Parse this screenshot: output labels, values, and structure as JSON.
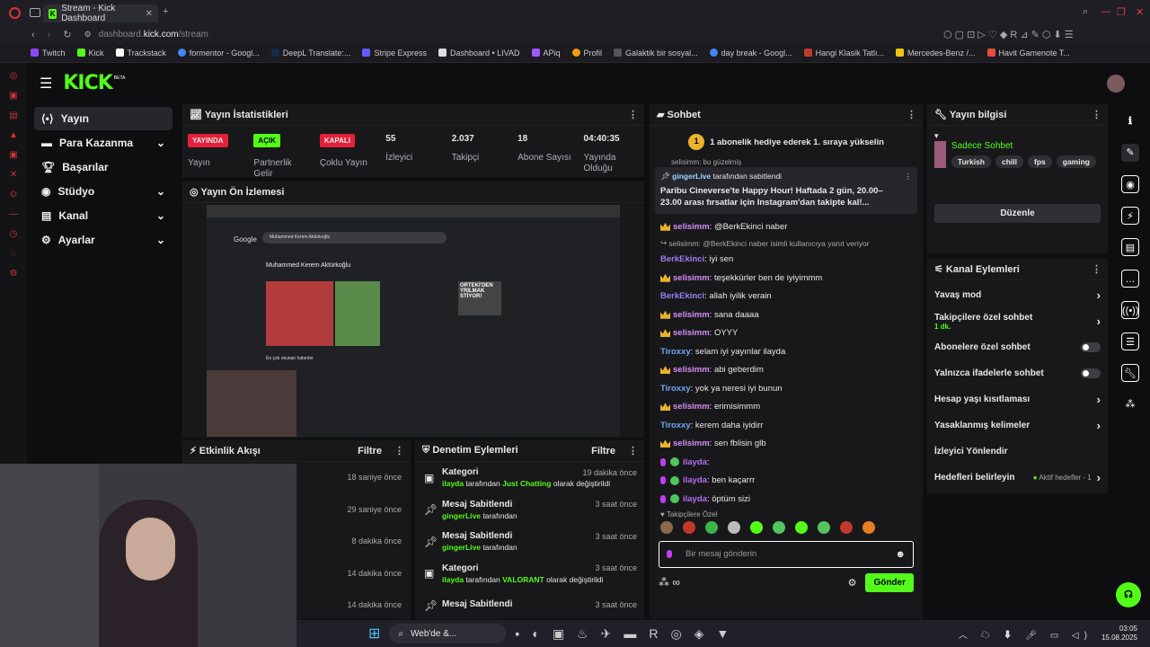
{
  "browser": {
    "tab_title": "Stream - Kick Dashboard",
    "url_domain": "dashboard.",
    "url_host": "kick.com",
    "url_path": "/stream",
    "bookmarks": [
      "Twitch",
      "Kick",
      "Trackstack",
      "formentor - Googl...",
      "DeepL Translate:...",
      "Stripe Express",
      "Dashboard • LIVAD",
      "APiq",
      "Profil",
      "Galaktik bir sosyal...",
      "day break - Googl...",
      "Hangi Klasik Tatlı...",
      "Mercedes-Benz /...",
      "Havit Gamenote T..."
    ]
  },
  "header": {
    "logo": "KICK",
    "beta": "BETA"
  },
  "sidebar": {
    "items": [
      {
        "label": "Yayın",
        "active": true,
        "expand": false
      },
      {
        "label": "Para Kazanma",
        "expand": true
      },
      {
        "label": "Başarılar",
        "expand": false
      },
      {
        "label": "Stüdyo",
        "expand": true
      },
      {
        "label": "Kanal",
        "expand": true
      },
      {
        "label": "Ayarlar",
        "expand": true
      }
    ]
  },
  "stats": {
    "title": "Yayın İstatistikleri",
    "cells": [
      {
        "pill": "YAYINDA",
        "pill_color": "#e5203a",
        "label": "Yayın"
      },
      {
        "pill": "AÇIK",
        "pill_color": "#53fc18",
        "label": "Partnerlik Gelir"
      },
      {
        "pill": "KAPALI",
        "pill_color": "#e5203a",
        "label": "Çoklu Yayın"
      },
      {
        "value": "55",
        "label": "İzleyici"
      },
      {
        "value": "2.037",
        "label": "Takipçi"
      },
      {
        "value": "18",
        "label": "Abone Sayısı"
      },
      {
        "value": "04:40:35",
        "label": "Yayında Olduğu"
      }
    ]
  },
  "preview": {
    "title": "Yayın Ön İzlemesi",
    "search_name": "Muhammed Kerem Aktürkoğlu",
    "headline": "Muhammed Kerem Aktürkoğlu",
    "news": "En çok okunan haberler",
    "overlay": "ORTEKİ'DEN YRILMAK STİYOR!"
  },
  "activity": {
    "title": "Etkinlik Akışı",
    "filter": "Filtre",
    "times": [
      "18 saniye önce",
      "29 saniye önce",
      "8 dakika önce",
      "14 dakika önce",
      "14 dakika önce"
    ]
  },
  "moderation": {
    "title": "Denetim Eylemleri",
    "filter": "Filtre",
    "items": [
      {
        "title": "Kategori",
        "time": "19 dakika önce",
        "user": "ilayda",
        "mid": "tarafından",
        "tag": "Just Chatting",
        "tail": "olarak değiştirildi"
      },
      {
        "title": "Mesaj Sabitlendi",
        "time": "3 saat önce",
        "user": "gingerLive",
        "mid": "tarafından",
        "tag": "",
        "tail": ""
      },
      {
        "title": "Mesaj Sabitlendi",
        "time": "3 saat önce",
        "user": "gingerLive",
        "mid": "tarafından",
        "tag": "",
        "tail": ""
      },
      {
        "title": "Kategori",
        "time": "3 saat önce",
        "user": "ilayda",
        "mid": "tarafından",
        "tag": "VALORANT",
        "tail": "olarak değiştirildi"
      },
      {
        "title": "Mesaj Sabitlendi",
        "time": "3 saat önce",
        "user": "",
        "mid": "",
        "tag": "",
        "tail": ""
      }
    ]
  },
  "chat": {
    "title": "Sohbet",
    "gift_count": "1",
    "gift_text": "1 abonelik hediye ederek 1. sıraya yükselin",
    "partial_top": "selisimm: bu güzelmiş",
    "pinned_by": "gingerLive",
    "pinned_suffix": "tarafından sabitlendi",
    "pinned_text": "Paribu Cineverse'te Happy Hour! Haftada 2 gün, 20.00–23.00 arası fırsatlar için Instagram'dan takipte kal!...",
    "reply_note": "selisimm: @BerkEkinci naber isimli kullanıcıya yanıt veriyor",
    "messages": [
      {
        "user": "selisimm",
        "text": "@BerkEkinci naber",
        "style": "y",
        "badge": "crown"
      },
      {
        "user": "BerkEkinci",
        "text": "iyi sen",
        "style": "b",
        "badge": ""
      },
      {
        "user": "selisimm",
        "text": "teşekkürler ben de iyiyimmm",
        "style": "y",
        "badge": "crown"
      },
      {
        "user": "BerkEkinci",
        "text": "allah iyilik verain",
        "style": "b",
        "badge": ""
      },
      {
        "user": "selisimm",
        "text": "sana daaaa",
        "style": "y",
        "badge": "crown"
      },
      {
        "user": "selisimm",
        "text": "OYYY",
        "style": "y",
        "badge": "crown"
      },
      {
        "user": "Tiroxxy",
        "text": "selam iyi yayınlar ilayda",
        "style": "t",
        "badge": ""
      },
      {
        "user": "selisimm",
        "text": "abi geberdim",
        "style": "y",
        "badge": "crown"
      },
      {
        "user": "Tiroxxy",
        "text": "yok ya neresi iyi bunun",
        "style": "t",
        "badge": ""
      },
      {
        "user": "selisimm",
        "text": "erimisimmm",
        "style": "y",
        "badge": "crown"
      },
      {
        "user": "Tiroxxy",
        "text": "kerem daha iyidirr",
        "style": "t",
        "badge": ""
      },
      {
        "user": "selisimm",
        "text": "sen fblisin glb",
        "style": "y",
        "badge": "crown"
      },
      {
        "user": "ilayda",
        "text": "",
        "style": "p",
        "badge": "mod"
      },
      {
        "user": "ilayda",
        "text": "ben kaçarrr",
        "style": "p",
        "badge": "mod"
      },
      {
        "user": "ilayda",
        "text": "öptüm sizi",
        "style": "p",
        "badge": "mod"
      }
    ],
    "emote_label": "Takipçilere Özel",
    "input_placeholder": "Bir mesaj gönderin",
    "send_label": "Gönder"
  },
  "stream_info": {
    "title": "Yayın bilgisi",
    "subtitle": "Sadece Sohbet",
    "tags": [
      "Turkish",
      "chill",
      "fps",
      "gaming"
    ],
    "edit_label": "Düzenle"
  },
  "channel_actions": {
    "title": "Kanal Eylemleri",
    "items": [
      {
        "label": "Yavaş mod",
        "type": "chevron",
        "sub": ""
      },
      {
        "label": "Takipçilere özel sohbet",
        "type": "chevron",
        "sub": "1 dk."
      },
      {
        "label": "Abonelere özel sohbet",
        "type": "toggle",
        "sub": ""
      },
      {
        "label": "Yalnızca ifadelerle sohbet",
        "type": "toggle",
        "sub": ""
      },
      {
        "label": "Hesap yaşı kısıtlaması",
        "type": "chevron",
        "sub": ""
      },
      {
        "label": "Yasaklanmış kelimeler",
        "type": "chevron",
        "sub": ""
      },
      {
        "label": "İzleyici Yönlendir",
        "type": "none",
        "sub": ""
      },
      {
        "label": "Hedefleri belirleyin",
        "type": "chevron",
        "sub": "Aktif hedefler - 1"
      }
    ]
  },
  "taskbar": {
    "search": "Web'de &...",
    "time": "03:05",
    "date": "15.08.2025"
  },
  "colors": {
    "accent": "#53fc18",
    "bg": "#0e0e10",
    "panel": "#18181b"
  }
}
